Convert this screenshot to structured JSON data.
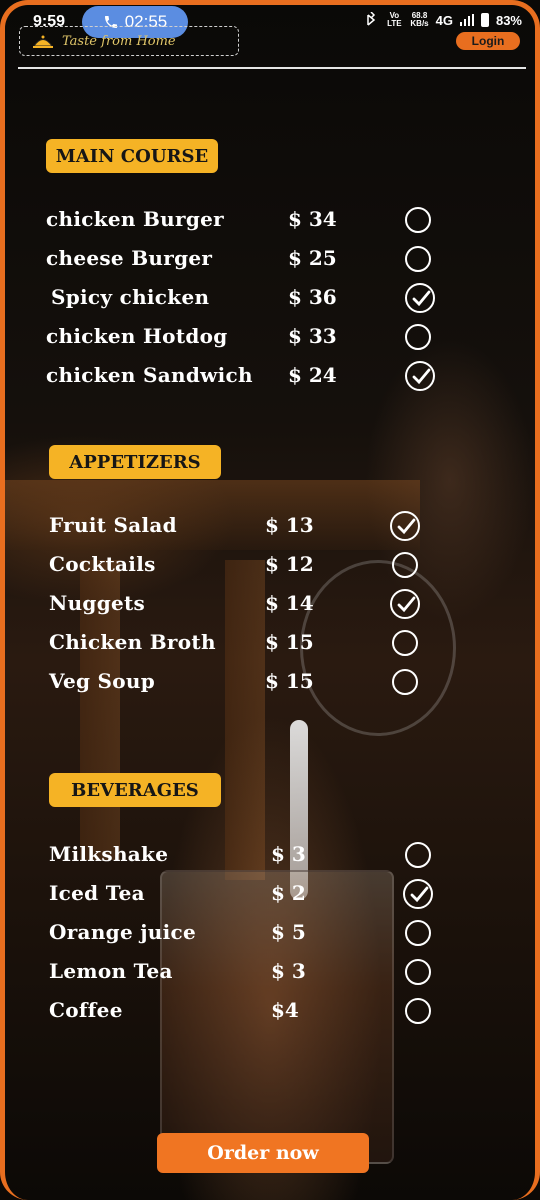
{
  "status_bar": {
    "time": "9:59",
    "call_timer": "02:55",
    "volte": "Vo LTE",
    "speed": "68.8",
    "speed_unit": "KB/s",
    "network": "4G",
    "battery": "83%"
  },
  "header": {
    "brand": "Taste from Home",
    "login_label": "Login"
  },
  "sections": [
    {
      "title": "MAIN COURSE",
      "items": [
        {
          "name": "chicken Burger",
          "price": "$ 34",
          "checked": false
        },
        {
          "name": "cheese Burger",
          "price": "$ 25",
          "checked": false
        },
        {
          "name": "Spicy chicken",
          "price": "$ 36",
          "checked": true
        },
        {
          "name": "chicken  Hotdog",
          "price": "$ 33",
          "checked": false
        },
        {
          "name": "chicken Sandwich",
          "price": "$ 24",
          "checked": true
        }
      ]
    },
    {
      "title": "APPETIZERS",
      "items": [
        {
          "name": "Fruit Salad",
          "price": "$ 13",
          "checked": true
        },
        {
          "name": "Cocktails",
          "price": "$ 12",
          "checked": false
        },
        {
          "name": "Nuggets",
          "price": "$ 14",
          "checked": true
        },
        {
          "name": "Chicken Broth",
          "price": "$ 15",
          "checked": false
        },
        {
          "name": "Veg Soup",
          "price": "$ 15",
          "checked": false
        }
      ]
    },
    {
      "title": "BEVERAGES",
      "items": [
        {
          "name": "Milkshake",
          "price": "$ 3",
          "checked": false
        },
        {
          "name": "Iced Tea",
          "price": "$ 2",
          "checked": true
        },
        {
          "name": "Orange juice",
          "price": "$ 5",
          "checked": false
        },
        {
          "name": "Lemon Tea",
          "price": "$ 3",
          "checked": false
        },
        {
          "name": "Coffee",
          "price": "$4",
          "checked": false
        }
      ]
    }
  ],
  "order_label": "Order now",
  "colors": {
    "accent": "#f07522",
    "section": "#f5b325",
    "frame": "#e86e1f"
  }
}
